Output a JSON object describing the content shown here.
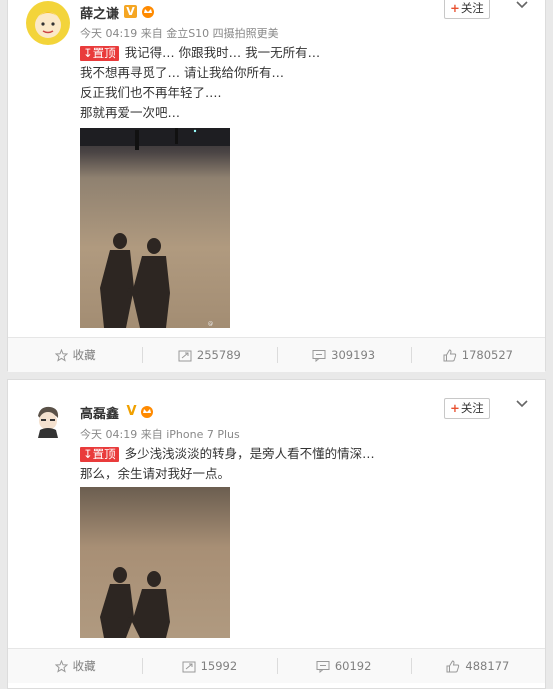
{
  "posts": [
    {
      "author": "薛之谦",
      "avatar_icon": "yellow-cartoon-avatar-icon",
      "meta_time": "今天 04:19",
      "meta_from": "来自",
      "meta_source": "金立S10 四摄拍照更美",
      "follow_label": "关注",
      "pin_label": "置顶",
      "lines": [
        "我记得… 你跟我时… 我一无所有…",
        "我不想再寻觅了… 请让我给你所有…",
        "反正我们也不再年轻了….",
        "那就再爱一次吧…"
      ],
      "actions": {
        "favorite": "收藏",
        "repost": "255789",
        "comment": "309193",
        "like": "1780527"
      }
    },
    {
      "author": "高磊鑫",
      "avatar_icon": "grey-cartoon-avatar-icon",
      "meta_time": "今天 04:19",
      "meta_from": "来自",
      "meta_source": "iPhone 7 Plus",
      "follow_label": "关注",
      "pin_label": "置顶",
      "lines": [
        "多少浅浅淡淡的转身，是旁人看不懂的情深…",
        "那么，余生请对我好一点。"
      ],
      "actions": {
        "favorite": "收藏",
        "repost": "15992",
        "comment": "60192",
        "like": "488177"
      }
    }
  ],
  "colors": {
    "verified_orange": "#f5a623",
    "verified_gold": "#f0a000",
    "pin_red": "#e93b3b"
  }
}
